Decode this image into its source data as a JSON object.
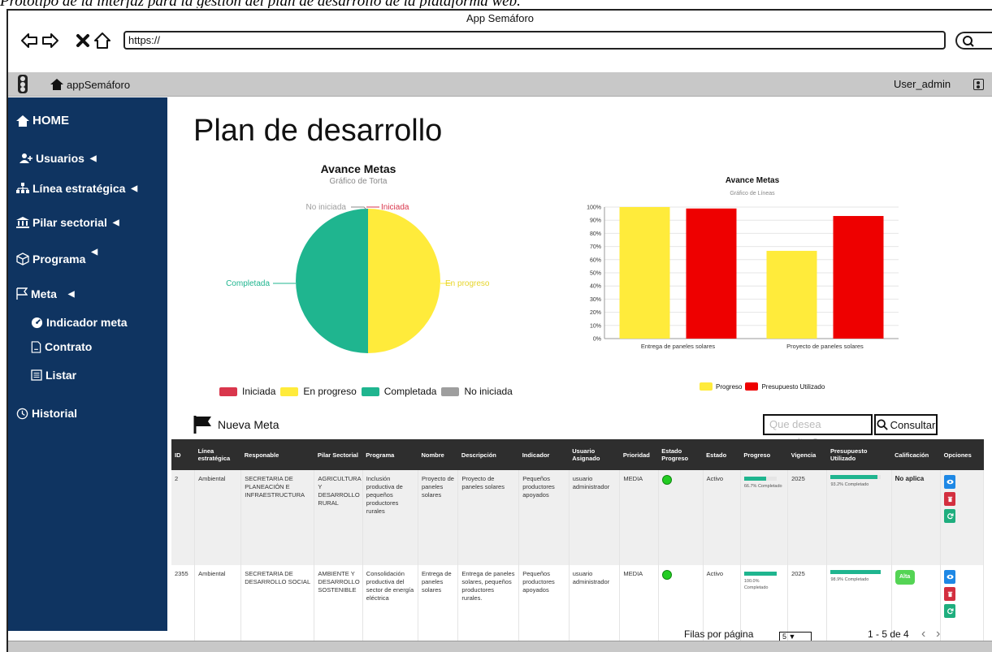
{
  "caption": "Prototipo de la interfaz para la gestión del plan de desarrollo de la plataforma web.",
  "window": {
    "title": "App Semáforo",
    "url": "https://"
  },
  "browser_icons": [
    "back-arrow-icon",
    "forward-arrow-icon",
    "close-x-icon",
    "home-icon",
    "search-icon"
  ],
  "appbar": {
    "brand": "appSemáforo",
    "user": "User_admin"
  },
  "sidebar": {
    "items": [
      {
        "label": "HOME",
        "icon": "home-icon"
      },
      {
        "label": "Usuarios",
        "icon": "add-user-icon"
      },
      {
        "label": "Línea estratégica",
        "icon": "sitemap-icon"
      },
      {
        "label": "Pilar sectorial",
        "icon": "institution-icon"
      },
      {
        "label": "Programa",
        "icon": "cube-icon"
      },
      {
        "label": "Meta",
        "icon": "flag-icon"
      },
      {
        "label": "Indicador meta",
        "icon": "gauge-icon"
      },
      {
        "label": "Contrato",
        "icon": "document-icon"
      },
      {
        "label": "Listar",
        "icon": "list-icon"
      },
      {
        "label": "Historial",
        "icon": "clock-icon"
      }
    ]
  },
  "main": {
    "title": "Plan de desarrollo",
    "nueva_meta": "Nueva Meta",
    "search_placeholder": "Que desea consultar?",
    "search_button": "Consultar"
  },
  "chart_data": [
    {
      "type": "pie",
      "title": "Avance Metas",
      "subtitle": "Gráfico de Torta",
      "slices": [
        {
          "label": "No iniciada",
          "value": 0,
          "color": "#9e9e9e"
        },
        {
          "label": "Iniciada",
          "value": 0,
          "color": "#d9364c"
        },
        {
          "label": "En progreso",
          "value": 1,
          "color": "#ffeb3b"
        },
        {
          "label": "Completada",
          "value": 1,
          "color": "#1fb58f"
        }
      ],
      "legend": [
        {
          "label": "Iniciada",
          "color": "#d9364c"
        },
        {
          "label": "En progreso",
          "color": "#ffeb3b"
        },
        {
          "label": "Completada",
          "color": "#1fb58f"
        },
        {
          "label": "No iniciada",
          "color": "#9e9e9e"
        }
      ],
      "legend_position": "bottom"
    },
    {
      "type": "bar",
      "title": "Avance Metas",
      "subtitle": "Gráfico de Líneas",
      "categories": [
        "Entrega de paneles solares",
        "Proyecto de paneles solares"
      ],
      "series": [
        {
          "name": "Progreso",
          "values": [
            100,
            66.7
          ],
          "color": "#ffeb3b"
        },
        {
          "name": "Presupuesto Utilizado",
          "values": [
            98.9,
            93.2
          ],
          "color": "#ee0000"
        }
      ],
      "ylim": [
        0,
        100
      ],
      "yticks": [
        "0%",
        "10%",
        "20%",
        "30%",
        "40%",
        "50%",
        "60%",
        "70%",
        "80%",
        "90%",
        "100%"
      ],
      "grid": true,
      "legend_position": "bottom"
    }
  ],
  "table": {
    "headers": [
      "ID",
      "Línea estratégica",
      "Responable",
      "Pilar Sectorial",
      "Programa",
      "Nombre",
      "Descripción",
      "Indicador",
      "Usuario Asignado",
      "Prioridad",
      "Estado Progreso",
      "Estado",
      "Progreso",
      "Vigencia",
      "Presupuesto Utilizado",
      "Calificación",
      "Opciones"
    ],
    "rows": [
      {
        "id": "2",
        "linea": "Ambiental",
        "responsable": "SECRETARIA DE PLANEACIÓN E INFRAESTRUCTURA",
        "pilar": "AGRICULTURA Y DESARROLLO RURAL",
        "programa": "Inclusión productiva de pequeños productores rurales",
        "nombre": "Proyecto de paneles solares",
        "descripcion": "Proyecto de paneles solares",
        "indicador": "Pequeños productores apoyados",
        "usuario": "usuario administrador",
        "prioridad": "MEDIA",
        "estado": "Activo",
        "progreso": 66.7,
        "progreso_text": "66.7% Completado",
        "vigencia": "2025",
        "presupuesto": 93.2,
        "presupuesto_text": "93.2% Completado",
        "calificacion": "No aplica"
      },
      {
        "id": "2355",
        "linea": "Ambiental",
        "responsable": "SECRETARIA DE DESARROLLO SOCIAL",
        "pilar": "AMBIENTE Y DESARROLLO SOSTENIBLE",
        "programa": "Consolidación productiva del sector de energía eléctrica",
        "nombre": "Entrega de paneles solares",
        "descripcion": "Entrega de paneles solares, pequeños productores rurales.",
        "indicador": "Pequeños productores apoyados",
        "usuario": "usuario administrador",
        "prioridad": "MEDIA",
        "estado": "Activo",
        "progreso": 100,
        "progreso_text": "100.0% Completado",
        "vigencia": "2025",
        "presupuesto": 98.9,
        "presupuesto_text": "98.9% Completado",
        "calificacion": "Alta"
      }
    ]
  },
  "pagination": {
    "label": "Filas por página",
    "rows_per_page": "5",
    "range": "1 - 5 de 4"
  }
}
